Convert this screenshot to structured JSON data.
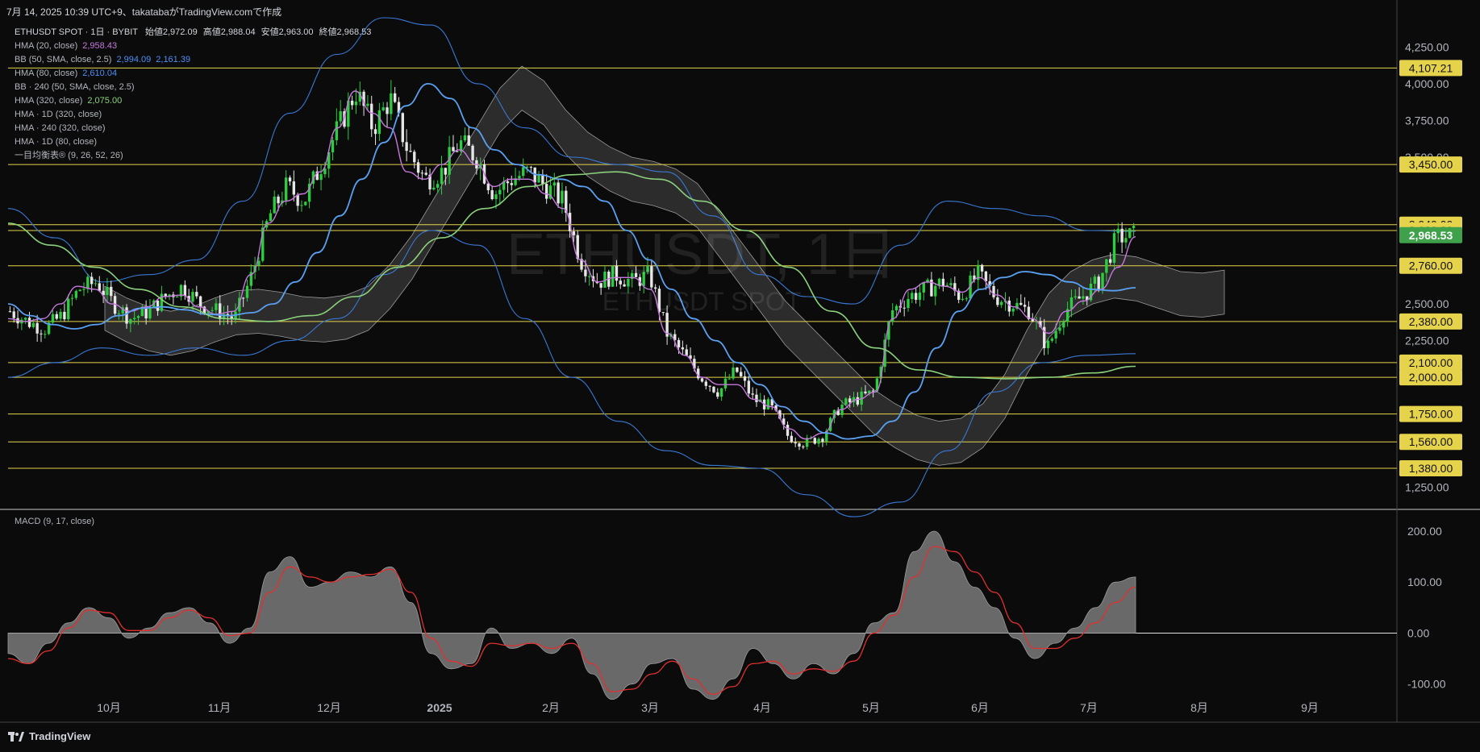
{
  "header": {
    "text": "7月 14, 2025 10:39 UTC+9、takatabaがTradingView.comで作成"
  },
  "legend": {
    "title_line": {
      "symbol": "ETHUSDT SPOT · 1日 · BYBIT",
      "o_label": "始値",
      "o": "2,972.09",
      "h_label": "高値",
      "h": "2,988.04",
      "l_label": "安値",
      "l": "2,963.00",
      "c_label": "終値",
      "c": "2,968.53"
    },
    "rows": [
      {
        "label": "HMA (20, close)",
        "v1": "2,958.43",
        "v2": "",
        "c1": "#c678dd",
        "c2": ""
      },
      {
        "label": "BB (50, SMA, close, 2.5)",
        "v1": "2,994.09",
        "v2": "2,161.39",
        "c1": "#4f8ef7",
        "c2": "#4f8ef7"
      },
      {
        "label": "HMA (80, close)",
        "v1": "2,610.04",
        "v2": "",
        "c1": "#4f8ef7",
        "c2": ""
      },
      {
        "label": "BB · 240 (50, SMA, close, 2.5)",
        "v1": "",
        "v2": "",
        "c1": "",
        "c2": ""
      },
      {
        "label": "HMA (320, close)",
        "v1": "2,075.00",
        "v2": "",
        "c1": "#8bd17c",
        "c2": ""
      },
      {
        "label": "HMA · 1D (320, close)",
        "v1": "",
        "v2": "",
        "c1": "",
        "c2": ""
      },
      {
        "label": "HMA · 240 (320, close)",
        "v1": "",
        "v2": "",
        "c1": "",
        "c2": ""
      },
      {
        "label": "HMA · 1D (80, close)",
        "v1": "",
        "v2": "",
        "c1": "",
        "c2": ""
      },
      {
        "label": "一目均衡表® (9, 26, 52, 26)",
        "v1": "",
        "v2": "",
        "c1": "",
        "c2": ""
      }
    ]
  },
  "watermark": {
    "big": "ETHUSDT, 1日",
    "small": "ETHUSDT SPOT"
  },
  "macd_legend": "MACD (9, 17, close)",
  "footer_brand": "TradingView",
  "colors": {
    "bg": "#0b0b0b",
    "up": "#2ecc40",
    "down": "#e6e6e6",
    "hline": "#e6d34c",
    "bb": "#3a78d4",
    "hma20": "#c678dd",
    "hma80": "#5aa0f0",
    "hma320": "#8bd17c",
    "cloud": "#555555",
    "macd_hist": "#8a8a8a",
    "signal": "#e03030",
    "price_tag": "#3fa24a"
  },
  "chart_data": [
    {
      "type": "line",
      "name_ref": "main price chart",
      "y_axis_ticks": [
        "4,250.00",
        "4,000.00",
        "3,750.00",
        "3,500.00",
        "2,500.00",
        "2,250.00",
        "1,250.00"
      ],
      "ylim": [
        1100,
        4450
      ],
      "x_axis_labels": [
        "10月",
        "11月",
        "12月",
        "2025",
        "2月",
        "3月",
        "4月",
        "5月",
        "6月",
        "7月",
        "8月",
        "9月"
      ],
      "horizontal_levels": [
        {
          "label": "4,107.21",
          "value": 4107.21
        },
        {
          "label": "3,450.00",
          "value": 3450
        },
        {
          "label": "3,040.00",
          "value": 3040
        },
        {
          "label": "3,000.00",
          "value": 3000
        },
        {
          "label": "2,760.00",
          "value": 2760
        },
        {
          "label": "2,380.00",
          "value": 2380
        },
        {
          "label": "2,100.00",
          "value": 2100
        },
        {
          "label": "2,000.00",
          "value": 2000
        },
        {
          "label": "1,750.00",
          "value": 1750
        },
        {
          "label": "1,560.00",
          "value": 1560
        },
        {
          "label": "1,380.00",
          "value": 1380
        }
      ],
      "last_price": {
        "label": "2,968.53",
        "value": 2968.53
      },
      "series_keypoints": {
        "close": [
          2450,
          2380,
          2330,
          2420,
          2600,
          2650,
          2500,
          2400,
          2450,
          2550,
          2620,
          2500,
          2450,
          2400,
          2700,
          3100,
          3300,
          3200,
          3450,
          3700,
          3950,
          3700,
          3900,
          3550,
          3350,
          3400,
          3600,
          3500,
          3250,
          3350,
          3400,
          3300,
          3200,
          2800,
          2650,
          2700,
          2650,
          2700,
          2300,
          2150,
          2000,
          1900,
          2050,
          1850,
          1800,
          1600,
          1550,
          1600,
          1800,
          1850,
          1900,
          2450,
          2550,
          2600,
          2650,
          2550,
          2700,
          2550,
          2500,
          2450,
          2200,
          2450,
          2550,
          2650,
          2950,
          2968
        ],
        "hma20": [
          2400,
          2380,
          2400,
          2500,
          2620,
          2600,
          2500,
          2450,
          2480,
          2550,
          2560,
          2480,
          2430,
          2450,
          2700,
          3050,
          3200,
          3250,
          3400,
          3700,
          3950,
          3800,
          3700,
          3400,
          3350,
          3450,
          3550,
          3450,
          3300,
          3350,
          3350,
          3250,
          3150,
          2800,
          2650,
          2680,
          2680,
          2600,
          2300,
          2150,
          2000,
          1950,
          1950,
          1850,
          1800,
          1650,
          1580,
          1620,
          1780,
          1850,
          1900,
          2400,
          2600,
          2650,
          2620,
          2580,
          2680,
          2560,
          2480,
          2400,
          2300,
          2450,
          2520,
          2600,
          2750,
          2958
        ],
        "hma80": [
          2500,
          2420,
          2360,
          2330,
          2360,
          2420,
          2470,
          2480,
          2460,
          2430,
          2420,
          2440,
          2500,
          2650,
          2850,
          3100,
          3350,
          3600,
          3850,
          4000,
          3900,
          3700,
          3550,
          3450,
          3380,
          3350,
          3300,
          3200,
          3000,
          2800,
          2600,
          2400,
          2250,
          2100,
          1950,
          1800,
          1700,
          1620,
          1580,
          1600,
          1700,
          1900,
          2200,
          2450,
          2600,
          2680,
          2720,
          2700,
          2650,
          2600,
          2590,
          2610
        ],
        "hma320": [
          3050,
          2900,
          2750,
          2600,
          2480,
          2400,
          2380,
          2420,
          2550,
          2750,
          2950,
          3150,
          3300,
          3380,
          3400,
          3350,
          3200,
          3000,
          2750,
          2450,
          2200,
          2050,
          2000,
          1990,
          2000,
          2030,
          2075
        ],
        "bb_upper": [
          3150,
          2950,
          2650,
          2700,
          2800,
          3200,
          3800,
          4200,
          4450,
          4400,
          4000,
          3700,
          3500,
          3450,
          3400,
          3100,
          2700,
          2550,
          2500,
          2900,
          3200,
          3150,
          3100,
          3000,
          2994
        ],
        "bb_lower": [
          2000,
          2100,
          2200,
          2150,
          2200,
          2150,
          2250,
          2400,
          2700,
          3000,
          2900,
          2400,
          2000,
          1700,
          1500,
          1400,
          1380,
          1200,
          1050,
          1150,
          1500,
          1900,
          2100,
          2150,
          2161
        ]
      }
    },
    {
      "type": "area",
      "name_ref": "MACD panel",
      "y_axis_ticks": [
        "200.00",
        "100.00",
        "0.00",
        "-100.00"
      ],
      "ylim": [
        -170,
        230
      ],
      "macd": [
        -40,
        -60,
        -20,
        20,
        50,
        30,
        -10,
        10,
        40,
        50,
        20,
        -20,
        10,
        120,
        150,
        90,
        100,
        120,
        110,
        130,
        60,
        -40,
        -70,
        -60,
        10,
        -30,
        -20,
        -40,
        -10,
        -80,
        -130,
        -100,
        -60,
        -50,
        -110,
        -130,
        -90,
        -30,
        -60,
        -90,
        -60,
        -80,
        -40,
        20,
        40,
        160,
        200,
        140,
        90,
        50,
        -10,
        -50,
        -20,
        10,
        50,
        100,
        110
      ],
      "signal": [
        -50,
        -60,
        -35,
        10,
        45,
        40,
        5,
        5,
        30,
        45,
        30,
        -5,
        0,
        80,
        130,
        110,
        100,
        110,
        115,
        125,
        80,
        -10,
        -55,
        -65,
        -20,
        -25,
        -20,
        -30,
        -20,
        -60,
        -115,
        -110,
        -80,
        -55,
        -90,
        -120,
        -105,
        -60,
        -55,
        -80,
        -70,
        -75,
        -55,
        0,
        35,
        110,
        170,
        160,
        120,
        80,
        20,
        -30,
        -30,
        -10,
        20,
        60,
        90
      ]
    }
  ]
}
